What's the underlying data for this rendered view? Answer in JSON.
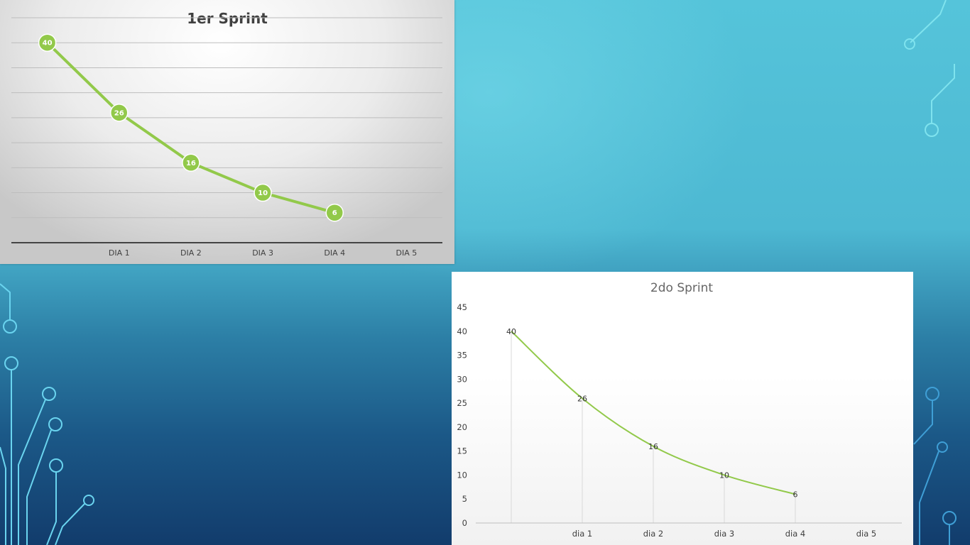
{
  "chart_data": [
    {
      "type": "line",
      "title": "1er Sprint",
      "categories": [
        "",
        "DIA 1",
        "DIA 2",
        "DIA 3",
        "DIA 4",
        "DIA 5"
      ],
      "series": [
        {
          "values": [
            40,
            26,
            16,
            10,
            6,
            null
          ]
        }
      ],
      "data_labels": true,
      "ylim": [
        0,
        45
      ],
      "grid": true,
      "y_tick_labels_shown": false,
      "line_color": "#92c94a"
    },
    {
      "type": "line",
      "title": "2do Sprint",
      "categories": [
        "",
        "dia 1",
        "dia 2",
        "dia 3",
        "dia 4",
        "dia 5"
      ],
      "series": [
        {
          "values": [
            40,
            26,
            16,
            10,
            6,
            null
          ]
        }
      ],
      "data_labels": true,
      "ylim": [
        0,
        45
      ],
      "yticks": [
        0,
        5,
        10,
        15,
        20,
        25,
        30,
        35,
        40,
        45
      ],
      "drop_lines": true,
      "line_color": "#92c94a"
    }
  ]
}
